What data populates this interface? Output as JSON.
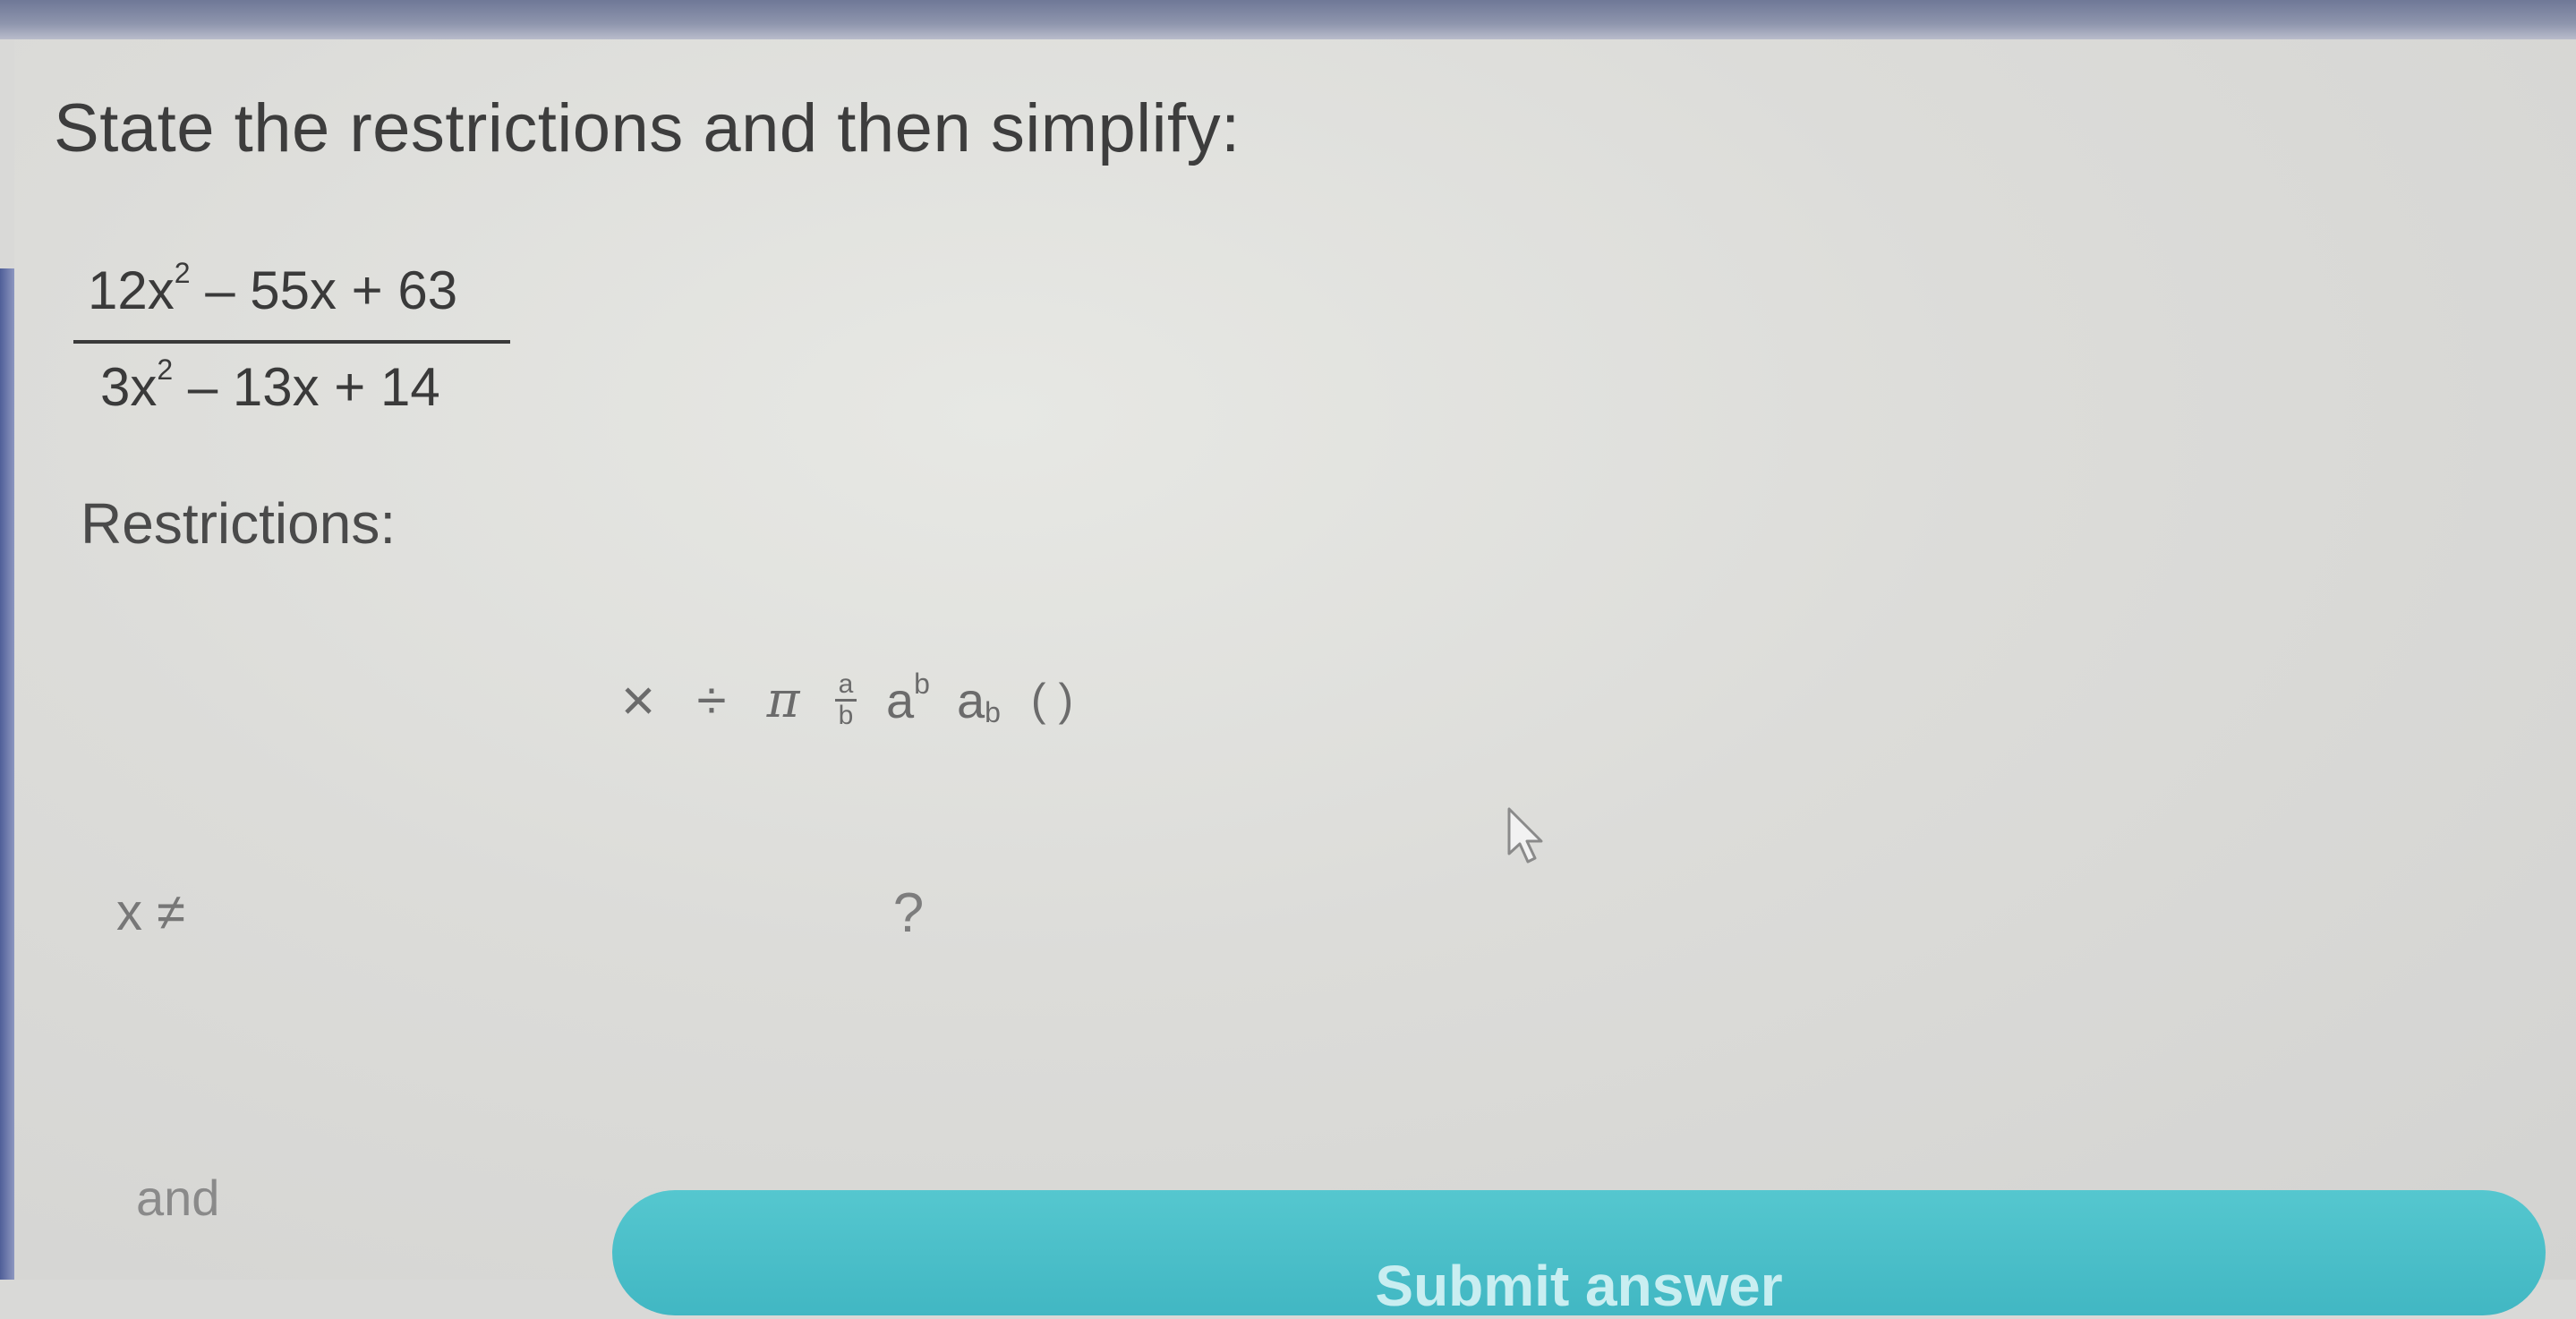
{
  "question": {
    "prompt": "State the restrictions and then simplify:",
    "expression": {
      "numerator": {
        "lead": "12x",
        "exponent": "2",
        "rest": " – 55x + 63"
      },
      "denominator": {
        "lead": "3x",
        "exponent": "2",
        "rest": " – 13x + 14"
      }
    }
  },
  "restrictions": {
    "label": "Restrictions:",
    "row_prefix": "x ≠",
    "input_placeholder": "?",
    "connector": "and"
  },
  "toolbar": {
    "times": "×",
    "divide": "÷",
    "pi": "π",
    "fraction_top": "a",
    "fraction_bottom": "b",
    "power_base": "a",
    "power_exp": "b",
    "subscript_base": "a",
    "subscript_sub": "b",
    "parens": "( )"
  },
  "submit": {
    "label": "Submit answer"
  },
  "colors": {
    "submit_button": "#49bec9",
    "page_background": "#dcdcd9"
  }
}
